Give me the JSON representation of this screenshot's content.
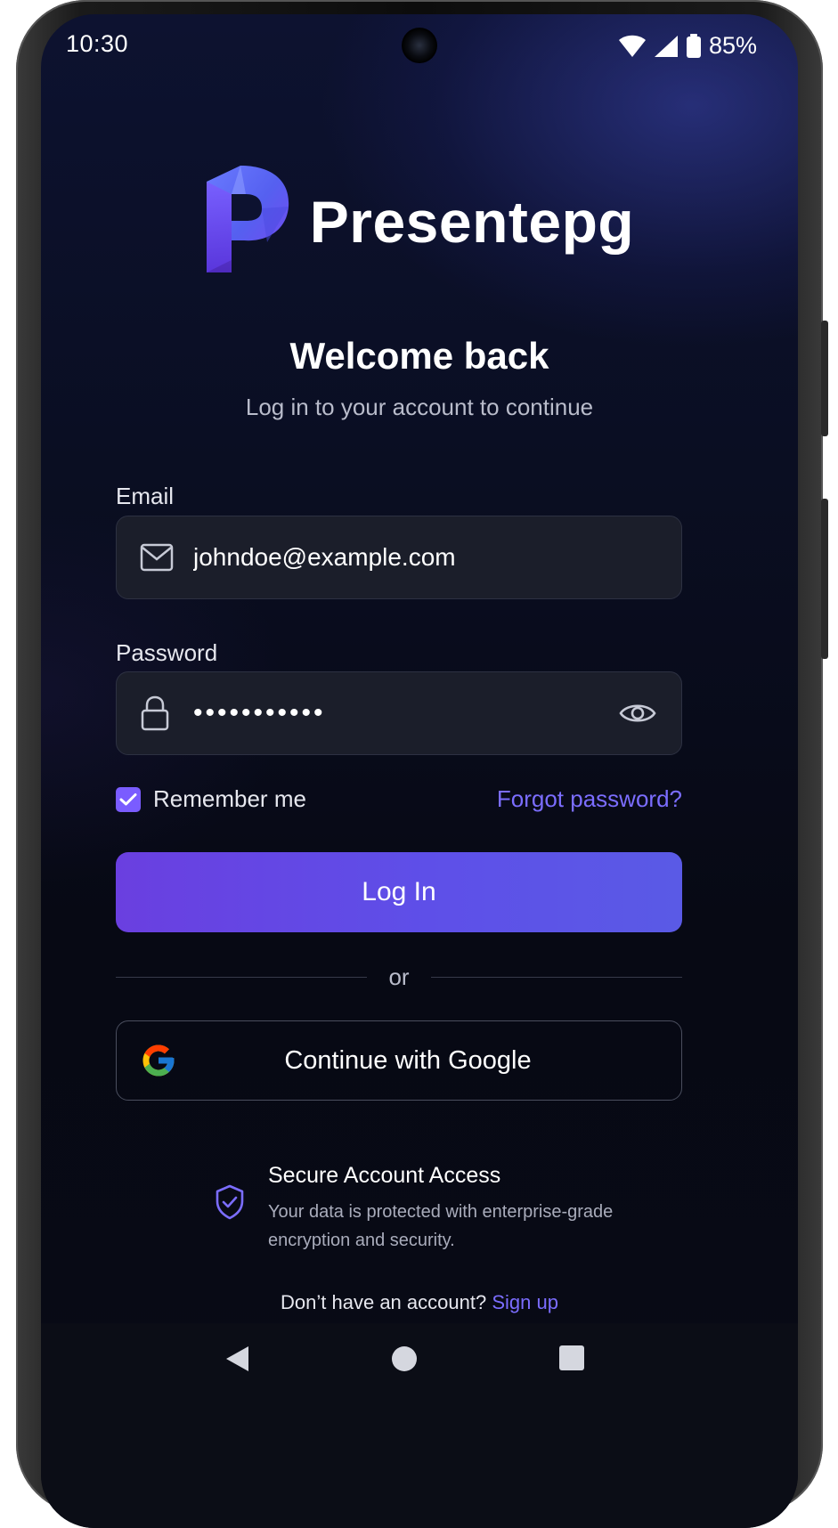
{
  "status_bar": {
    "time": "10:30",
    "battery": "85%",
    "icons": [
      "wifi-icon",
      "signal-icon",
      "battery-icon"
    ]
  },
  "brand": {
    "name": "Presentepg",
    "logo_icon": "p-logo-icon",
    "logo_colors": [
      "#5a63ff",
      "#7a4cff",
      "#3b48e0"
    ]
  },
  "header": {
    "title": "Welcome back",
    "subtitle": "Log in to your account to continue"
  },
  "form": {
    "email": {
      "label": "Email",
      "value": "johndoe@example.com",
      "icon": "envelope-icon"
    },
    "password": {
      "label": "Password",
      "masked_value": "•••••••••••",
      "icon": "lock-icon",
      "toggle_icon": "eye-icon"
    },
    "remember_me": {
      "label": "Remember me",
      "checked": true
    },
    "forgot_password": "Forgot password?",
    "login_button": "Log In",
    "divider": "or",
    "google_button": "Continue with Google"
  },
  "security_note": {
    "icon": "shield-check-icon",
    "title": "Secure Account Access",
    "description": "Your data is protected with enterprise-grade encryption and security."
  },
  "signup": {
    "prompt": "Don’t have an account?",
    "link": "Sign up"
  },
  "nav_bar": {
    "items": [
      "back-icon",
      "home-icon",
      "recents-icon"
    ]
  },
  "colors": {
    "accent": "#7b6dff",
    "button_gradient_start": "#6a3fe0",
    "button_gradient_end": "#5a5ae6",
    "background": "#070914",
    "field_bg": "#1b1e2a"
  }
}
